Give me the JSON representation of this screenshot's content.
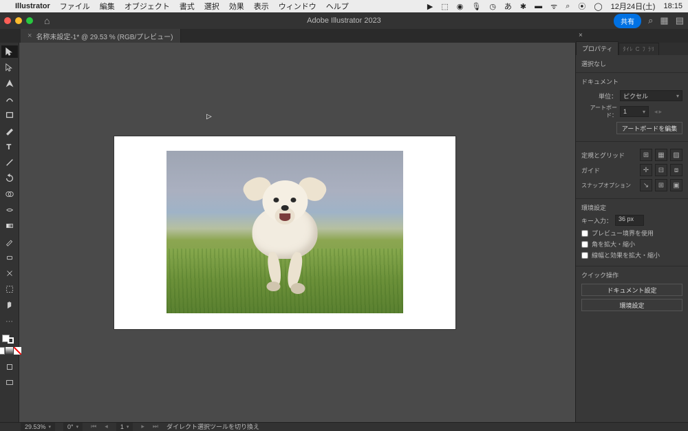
{
  "menubar": {
    "app": "Illustrator",
    "items": [
      "ファイル",
      "編集",
      "オブジェクト",
      "書式",
      "選択",
      "効果",
      "表示",
      "ウィンドウ",
      "ヘルプ"
    ],
    "date": "12月24日(土)",
    "time": "18:15"
  },
  "toolbar": {
    "title": "Adobe Illustrator 2023",
    "share": "共有"
  },
  "doc_tab": {
    "name": "名称未設定-1* @ 29.53 % (RGB/プレビュー)"
  },
  "panel": {
    "tab_active": "プロパティ",
    "tab_inactive": "ﾀｲﾚ C ﾌ ﾗﾘ",
    "no_selection": "選択なし",
    "document": "ドキュメント",
    "unit_label": "単位：",
    "unit_value": "ピクセル",
    "artboard_label": "アートボード：",
    "artboard_value": "1",
    "edit_artboard": "アートボードを編集",
    "ruler_grid": "定規とグリッド",
    "guide": "ガイド",
    "snap": "スナップオプション",
    "prefs": "環境設定",
    "key_input_label": "キー入力：",
    "key_input_value": "36 px",
    "cb1": "プレビュー境界を使用",
    "cb2": "角を拡大・縮小",
    "cb3": "線幅と効果を拡大・縮小",
    "quick": "クイック操作",
    "btn_doc_setup": "ドキュメント設定",
    "btn_prefs": "環境設定"
  },
  "statusbar": {
    "zoom": "29.53%",
    "rotate": "0°",
    "artboard_nav": "1",
    "hint": "ダイレクト選択ツールを切り換え"
  }
}
